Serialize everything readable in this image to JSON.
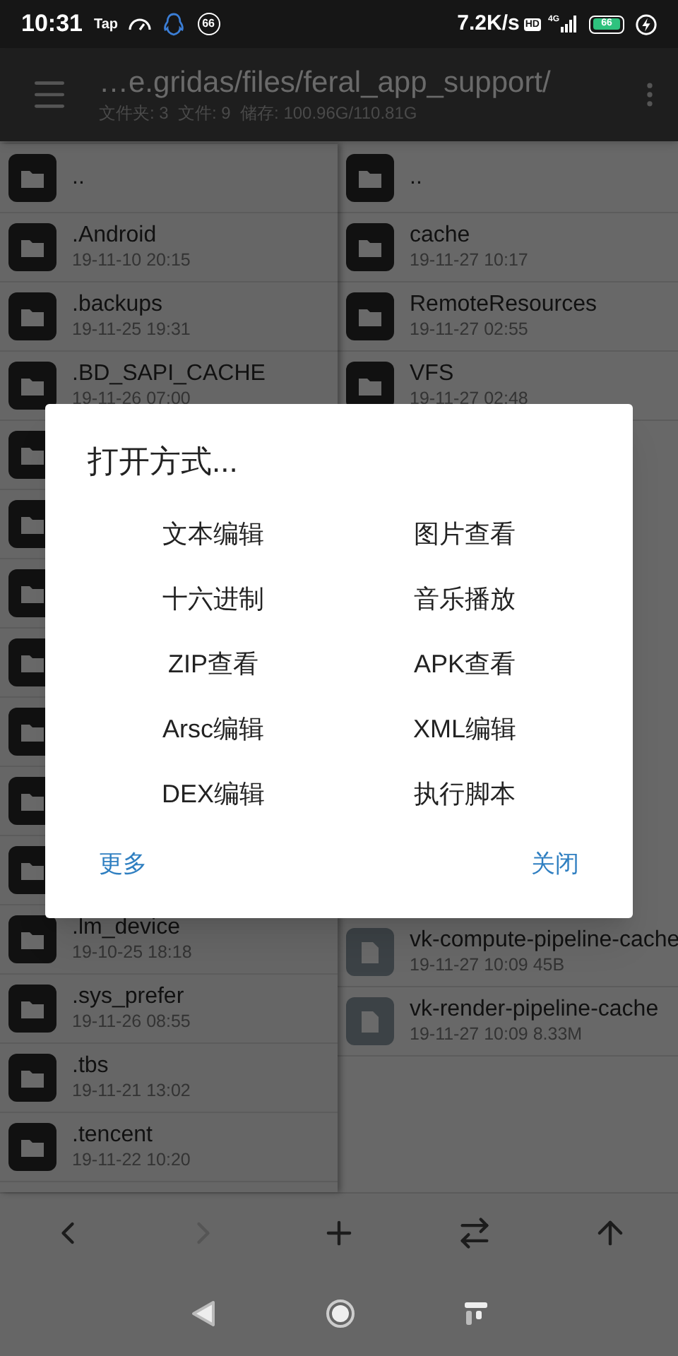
{
  "status_bar": {
    "time": "10:31",
    "app_label": "Tap",
    "badge": "66",
    "speed": "7.2K/s",
    "hd": "HD",
    "network": "4G",
    "battery": "66"
  },
  "toolbar": {
    "path": "…e.gridas/files/feral_app_support/",
    "info": "文件夹: 3  文件: 9  储存: 100.96G/110.81G"
  },
  "left_list": [
    {
      "kind": "folder",
      "name": ".."
    },
    {
      "kind": "folder",
      "name": ".Android",
      "date": "19-11-10 20:15"
    },
    {
      "kind": "folder",
      "name": ".backups",
      "date": "19-11-25 19:31"
    },
    {
      "kind": "folder",
      "name": ".BD_SAPI_CACHE",
      "date": "19-11-26 07:00"
    },
    {
      "kind": "folder"
    },
    {
      "kind": "folder"
    },
    {
      "kind": "folder"
    },
    {
      "kind": "folder"
    },
    {
      "kind": "folder"
    },
    {
      "kind": "folder"
    },
    {
      "kind": "folder"
    },
    {
      "kind": "folder",
      "name": ".lm_device",
      "date": "19-10-25 18:18"
    },
    {
      "kind": "folder",
      "name": ".sys_prefer",
      "date": "19-11-26 08:55"
    },
    {
      "kind": "folder",
      "name": ".tbs",
      "date": "19-11-21 13:02"
    },
    {
      "kind": "folder",
      "name": ".tencent",
      "date": "19-11-22 10:20"
    }
  ],
  "right_list": [
    {
      "kind": "folder",
      "name": ".."
    },
    {
      "kind": "folder",
      "name": "cache",
      "date": "19-11-27 10:17"
    },
    {
      "kind": "folder",
      "name": "RemoteResources",
      "date": "19-11-27 02:55"
    },
    {
      "kind": "folder",
      "name": "VFS",
      "date": "19-11-27 02:48"
    },
    {
      "kind": "file",
      "name": "vk-compute-pipeline-cache",
      "date": "19-11-27 10:09",
      "size": "45B"
    },
    {
      "kind": "file",
      "name": "vk-render-pipeline-cache",
      "date": "19-11-27 10:09",
      "size": "8.33M"
    }
  ],
  "dialog": {
    "title": "打开方式...",
    "options": [
      "文本编辑",
      "图片查看",
      "十六进制",
      "音乐播放",
      "ZIP查看",
      "APK查看",
      "Arsc编辑",
      "XML编辑",
      "DEX编辑",
      "执行脚本"
    ],
    "buttons": [
      "更多",
      "关闭"
    ]
  },
  "bottom_bar": [
    {
      "kind": "back",
      "disabled": false
    },
    {
      "kind": "forward",
      "disabled": true
    },
    {
      "kind": "add",
      "disabled": false
    },
    {
      "kind": "swap",
      "disabled": false
    },
    {
      "kind": "up",
      "disabled": false
    }
  ]
}
